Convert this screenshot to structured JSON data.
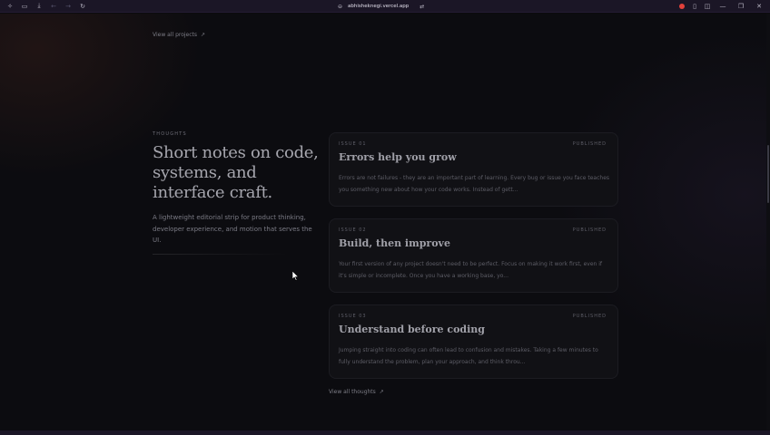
{
  "browser": {
    "url": "abhisheknegi.vercel.app",
    "icons": {
      "left": [
        "workspaces-icon",
        "sidebar-icon",
        "download-icon",
        "back-icon",
        "forward-icon",
        "reload-icon"
      ],
      "right": [
        "extension-icon",
        "bookmark-icon",
        "split-view-icon",
        "minimize-icon",
        "maximize-icon",
        "close-icon"
      ]
    },
    "accent": "#e2413b"
  },
  "projects": {
    "view_all_label": "View all projects"
  },
  "thoughts": {
    "eyebrow": "THOUGHTS",
    "headline": "Short notes on code, systems, and interface craft.",
    "subtext": "A lightweight editorial strip for product thinking, developer experience, and motion that serves the UI.",
    "view_all_label": "View all thoughts",
    "cards": [
      {
        "issue": "ISSUE 01",
        "status": "PUBLISHED",
        "title": "Errors help you grow",
        "excerpt": "Errors are not failures - they are an important part of learning. Every bug or issue you face teaches you something new about how your code works. Instead of gett..."
      },
      {
        "issue": "ISSUE 02",
        "status": "PUBLISHED",
        "title": "Build, then improve",
        "excerpt": "Your first version of any project doesn't need to be perfect. Focus on making it work first, even if it's simple or incomplete. Once you have a working base, yo..."
      },
      {
        "issue": "ISSUE 03",
        "status": "PUBLISHED",
        "title": "Understand before coding",
        "excerpt": "Jumping straight into coding can often lead to confusion and mistakes. Taking a few minutes to fully understand the problem, plan your approach, and think throu..."
      }
    ]
  }
}
